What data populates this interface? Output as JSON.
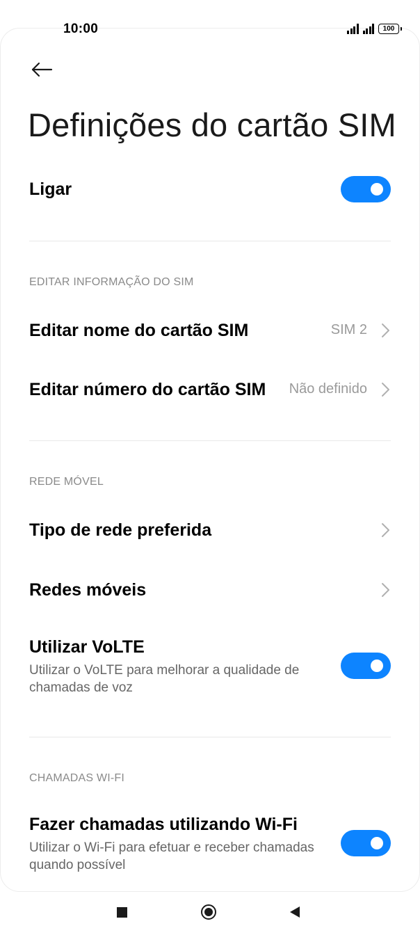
{
  "status_bar": {
    "time": "10:00",
    "battery": "100",
    "icons": [
      "signal-icon",
      "signal-icon",
      "battery-icon"
    ]
  },
  "header": {
    "back_icon": "arrow-left-icon",
    "title": "Definições do cartão SIM"
  },
  "power": {
    "label": "Ligar",
    "enabled": true
  },
  "sim_info": {
    "section_title": "EDITAR INFORMAÇÃO DO SIM",
    "edit_name": {
      "label": "Editar nome do cartão SIM",
      "value": "SIM 2"
    },
    "edit_number": {
      "label": "Editar número do cartão SIM",
      "value": "Não definido"
    }
  },
  "mobile_network": {
    "section_title": "REDE MÓVEL",
    "preferred_network": {
      "label": "Tipo de rede preferida"
    },
    "mobile_networks": {
      "label": "Redes móveis"
    },
    "volte": {
      "label": "Utilizar VoLTE",
      "description": "Utilizar o VoLTE para melhorar a qualidade de chamadas de voz",
      "enabled": true
    }
  },
  "wifi_calling": {
    "section_title": "CHAMADAS WI-FI",
    "wifi_calls": {
      "label": "Fazer chamadas utilizando Wi-Fi",
      "description": "Utilizar o Wi-Fi para efetuar e receber chamadas quando possível",
      "enabled": true
    }
  },
  "colors": {
    "accent": "#0d84ff",
    "secondary_text": "#666666",
    "section_header": "#8a8a8a"
  },
  "nav_bar": {
    "icons": [
      "recents-icon",
      "home-icon",
      "back-icon"
    ]
  }
}
